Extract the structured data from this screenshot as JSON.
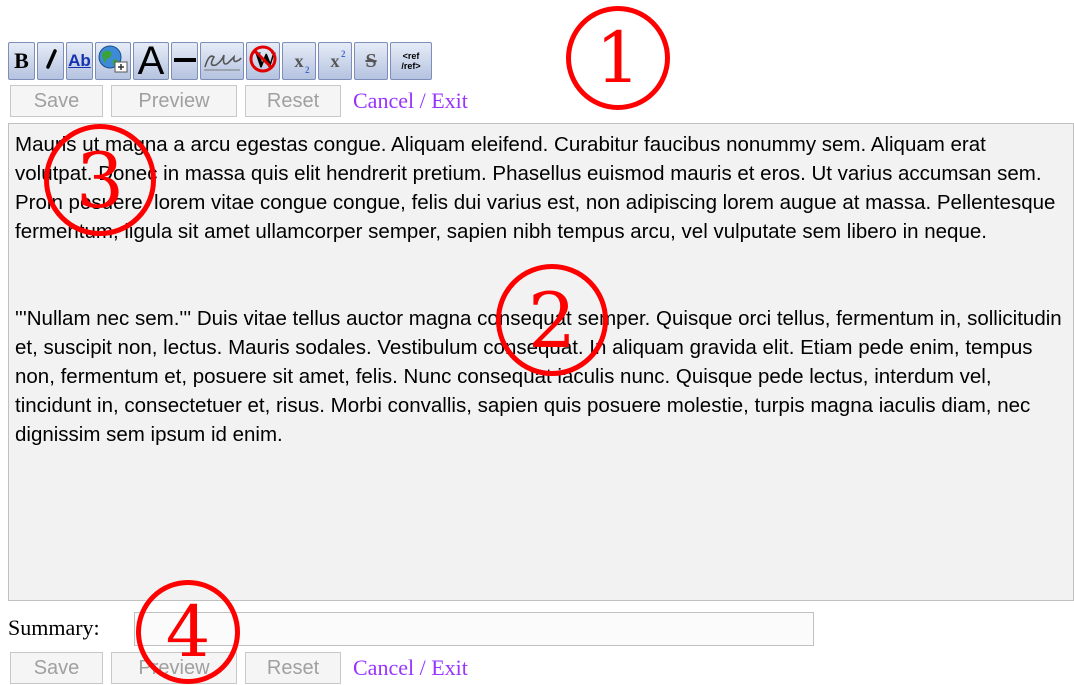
{
  "toolbar": {
    "buttons": [
      {
        "id": "bold",
        "label": "B",
        "icon": "bold-icon"
      },
      {
        "id": "italic",
        "label": "/",
        "icon": "italic-icon"
      },
      {
        "id": "internal-link",
        "label": "Ab",
        "icon": "internal-link-icon"
      },
      {
        "id": "external-link",
        "label": "",
        "icon": "globe-link-icon"
      },
      {
        "id": "headline",
        "label": "A",
        "icon": "headline-icon"
      },
      {
        "id": "horizontal-rule",
        "label": "",
        "icon": "horizontal-line-icon"
      },
      {
        "id": "signature",
        "label": "",
        "icon": "signature-icon"
      },
      {
        "id": "nowiki",
        "label": "W",
        "icon": "nowiki-icon"
      },
      {
        "id": "subscript",
        "label": "x",
        "sub": "2",
        "icon": "subscript-icon"
      },
      {
        "id": "superscript",
        "label": "x",
        "sup": "2",
        "icon": "superscript-icon"
      },
      {
        "id": "strikethrough",
        "label": "S",
        "icon": "strikethrough-icon"
      },
      {
        "id": "reference",
        "line1": "<ref",
        "line2": "/ref>",
        "icon": "reference-icon"
      }
    ]
  },
  "actions_top": {
    "save": "Save",
    "preview": "Preview",
    "reset": "Reset",
    "cancel": "Cancel / Exit"
  },
  "actions_bottom": {
    "save": "Save",
    "preview": "Preview",
    "reset": "Reset",
    "cancel": "Cancel / Exit"
  },
  "editor": {
    "paragraph1": "Mauris ut magna a arcu egestas congue. Aliquam eleifend. Curabitur faucibus nonummy sem. Aliquam erat volutpat. Donec in massa quis elit hendrerit pretium. Phasellus euismod mauris et eros. Ut varius accumsan sem. Proin posuere, lorem vitae congue congue, felis dui varius est, non adipiscing lorem augue at massa. Pellentesque fermentum, ligula sit amet ullamcorper semper, sapien nibh tempus arcu, vel vulputate sem libero in neque.",
    "paragraph2": "'''Nullam nec sem.''' Duis vitae tellus auctor magna consequat semper. Quisque orci tellus, fermentum in, sollicitudin et, suscipit non, lectus. Mauris sodales. Vestibulum consequat. In aliquam gravida elit. Etiam pede enim, tempus non, fermentum et, posuere sit amet, felis. Nunc consequat iaculis nunc. Quisque pede lectus, interdum vel, tincidunt in, consectetuer et, risus. Morbi convallis, sapien quis posuere molestie, turpis magna iaculis diam, nec dignissim sem ipsum id enim."
  },
  "summary": {
    "label": "Summary:",
    "value": ""
  },
  "callouts": {
    "c1": "①",
    "c2": "②",
    "c3": "③",
    "c4": "④"
  },
  "colors": {
    "callout": "#ff0000",
    "cancel_link": "#9933ff",
    "toolbar_blue": "#1533b0"
  }
}
